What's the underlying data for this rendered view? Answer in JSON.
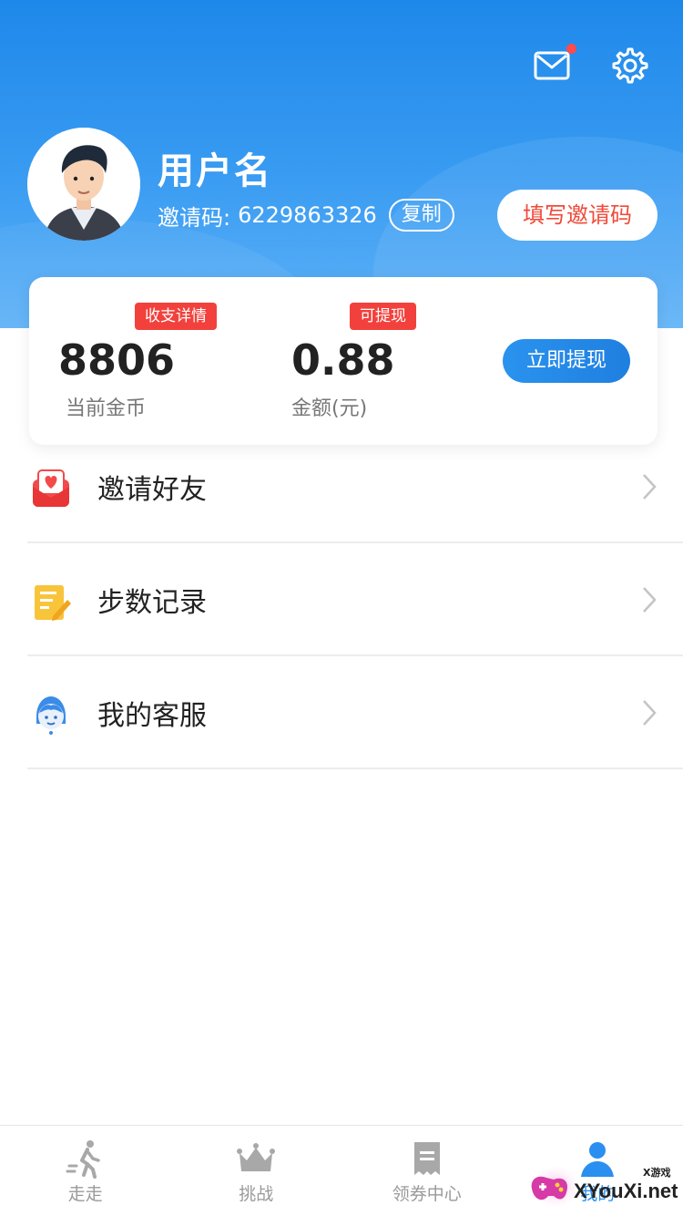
{
  "header": {
    "username": "用户名",
    "invite_label": "邀请码:",
    "invite_code": "6229863326",
    "copy_label": "复制",
    "fill_invite_label": "填写邀请码",
    "has_unread_mail": true
  },
  "wallet": {
    "detail_tag": "收支详情",
    "withdrawable_tag": "可提现",
    "coins_value": "8806",
    "coins_label": "当前金币",
    "amount_value": "0.88",
    "amount_label": "金额(元)",
    "withdraw_label": "立即提现"
  },
  "menu": [
    {
      "label": "邀请好友",
      "icon": "gift-heart-icon"
    },
    {
      "label": "步数记录",
      "icon": "notepad-pencil-icon"
    },
    {
      "label": "我的客服",
      "icon": "customer-service-icon"
    }
  ],
  "tabbar": [
    {
      "label": "走走",
      "icon": "walking-icon"
    },
    {
      "label": "挑战",
      "icon": "crown-icon"
    },
    {
      "label": "领券中心",
      "icon": "coupon-icon"
    },
    {
      "label": "我的",
      "icon": "user-icon",
      "active": true
    }
  ],
  "watermark": {
    "text": "XYouXi.net",
    "small": "X游戏"
  },
  "colors": {
    "primary": "#1e88ea",
    "accent_red": "#f2413c",
    "text": "#222222",
    "muted": "#777777"
  }
}
